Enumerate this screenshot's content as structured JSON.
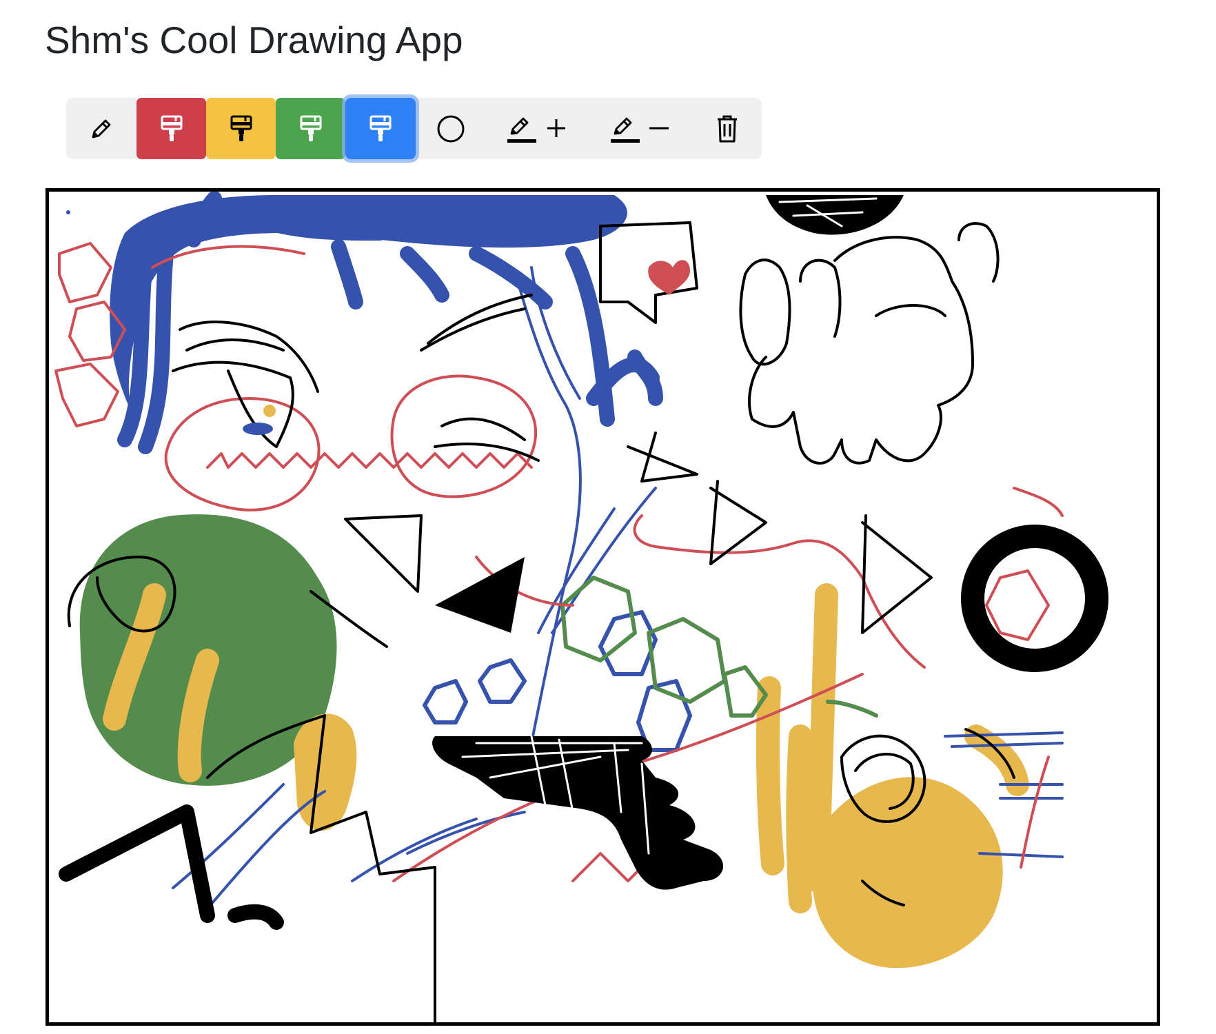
{
  "app": {
    "title": "Shm's Cool Drawing App"
  },
  "toolbar": {
    "tools": [
      {
        "name": "pencil",
        "label": "Pencil",
        "icon": "pencil-icon",
        "selected": false
      },
      {
        "name": "brush-red",
        "label": "Red brush",
        "icon": "brush-icon",
        "color": "#cf3f4b",
        "selected": false
      },
      {
        "name": "brush-yellow",
        "label": "Yellow brush",
        "icon": "brush-icon",
        "color": "#f5c342",
        "selected": false
      },
      {
        "name": "brush-green",
        "label": "Green brush",
        "icon": "brush-icon",
        "color": "#4ca44f",
        "selected": false
      },
      {
        "name": "brush-blue",
        "label": "Blue brush",
        "icon": "brush-icon",
        "color": "#2f80f7",
        "selected": true
      },
      {
        "name": "circle",
        "label": "Circle",
        "icon": "circle-icon",
        "selected": false
      },
      {
        "name": "size-increase",
        "label": "Increase line width",
        "icon": "pencil-plus-icon",
        "selected": false
      },
      {
        "name": "size-decrease",
        "label": "Decrease line width",
        "icon": "pencil-minus-icon",
        "selected": false
      },
      {
        "name": "clear",
        "label": "Clear",
        "icon": "trash-icon",
        "selected": false
      }
    ]
  },
  "colors": {
    "red": "#cf4e55",
    "yellow": "#e7b84d",
    "green": "#548c4d",
    "blue": "#3552ad",
    "black": "#000000"
  },
  "canvas": {
    "label": "Drawing canvas",
    "description": "Freehand drawing with colored brush strokes, scribbles, circles and a rabbit outline"
  }
}
